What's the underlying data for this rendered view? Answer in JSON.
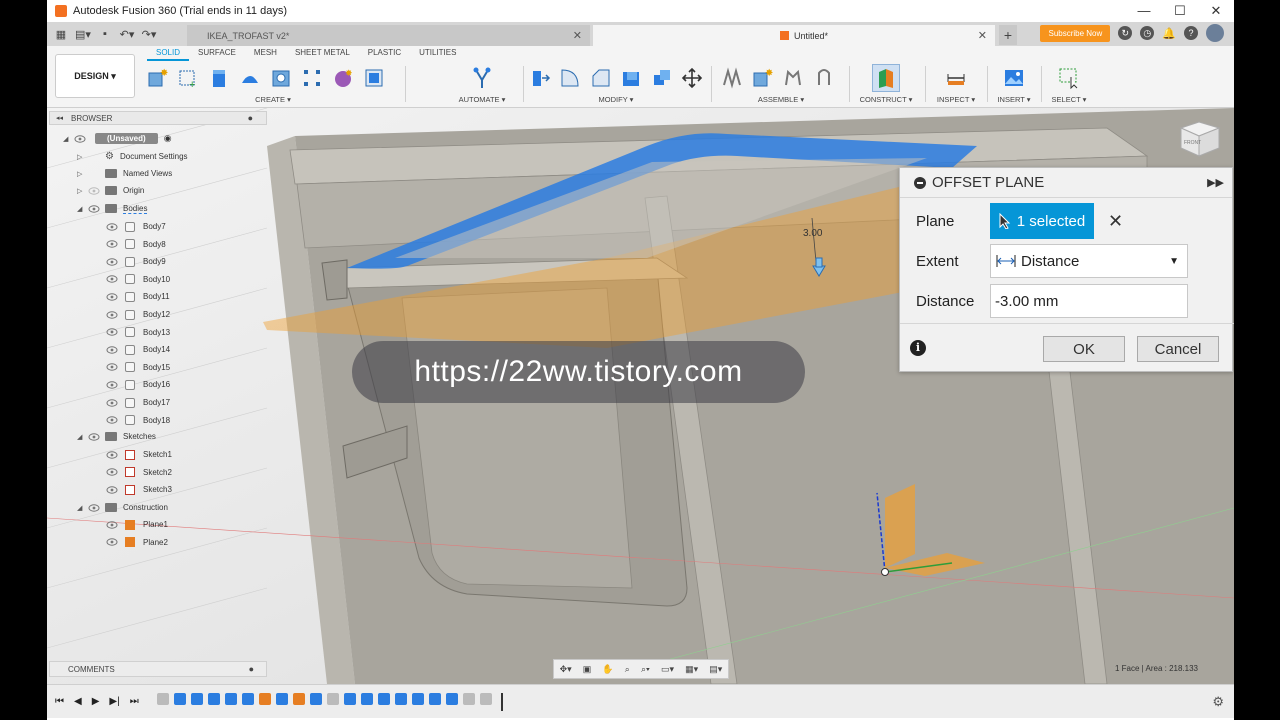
{
  "window": {
    "title": "Autodesk Fusion 360 (Trial ends in 11 days)",
    "controls": {
      "minimize": "—",
      "maximize": "☐",
      "close": "✕"
    }
  },
  "tabs": {
    "inactive_doc": "IKEA_TROFAST v2*",
    "active_doc": "Untitled*",
    "close": "✕",
    "new_tab": "+",
    "subscribe": "Subscribe Now",
    "user_help": "?"
  },
  "ribbon": {
    "workspace": "DESIGN ▾",
    "tabs": [
      "SOLID",
      "SURFACE",
      "MESH",
      "SHEET METAL",
      "PLASTIC",
      "UTILITIES"
    ],
    "active_tab": "SOLID",
    "groups": [
      "CREATE ▾",
      "AUTOMATE ▾",
      "MODIFY ▾",
      "ASSEMBLE ▾",
      "CONSTRUCT ▾",
      "INSPECT ▾",
      "INSERT ▾",
      "SELECT ▾"
    ]
  },
  "browser": {
    "title": "BROWSER",
    "root": "(Unsaved)",
    "items": {
      "document_settings": "Document Settings",
      "named_views": "Named Views",
      "origin": "Origin",
      "bodies": "Bodies",
      "body_list": [
        "Body7",
        "Body8",
        "Body9",
        "Body10",
        "Body11",
        "Body12",
        "Body13",
        "Body14",
        "Body15",
        "Body16",
        "Body17",
        "Body18"
      ],
      "sketches": "Sketches",
      "sketch_list": [
        "Sketch1",
        "Sketch2",
        "Sketch3"
      ],
      "construction": "Construction",
      "plane_list": [
        "Plane1",
        "Plane2"
      ]
    }
  },
  "comments": {
    "title": "COMMENTS"
  },
  "viewport": {
    "dimension_label": "3.00",
    "status": "1 Face | Area : 218.133",
    "watermark": "https://22ww.tistory.com",
    "viewcube_face": "FRONT"
  },
  "dialog": {
    "title": "OFFSET PLANE",
    "plane_label": "Plane",
    "plane_value": "1 selected",
    "extent_label": "Extent",
    "extent_value": "Distance",
    "distance_label": "Distance",
    "distance_value": "-3.00 mm",
    "ok": "OK",
    "cancel": "Cancel"
  },
  "colors": {
    "accent": "#0696d7",
    "subscribe": "#f7941d",
    "plane_orange": "#f0a030",
    "selection_blue": "#2b7de0"
  }
}
